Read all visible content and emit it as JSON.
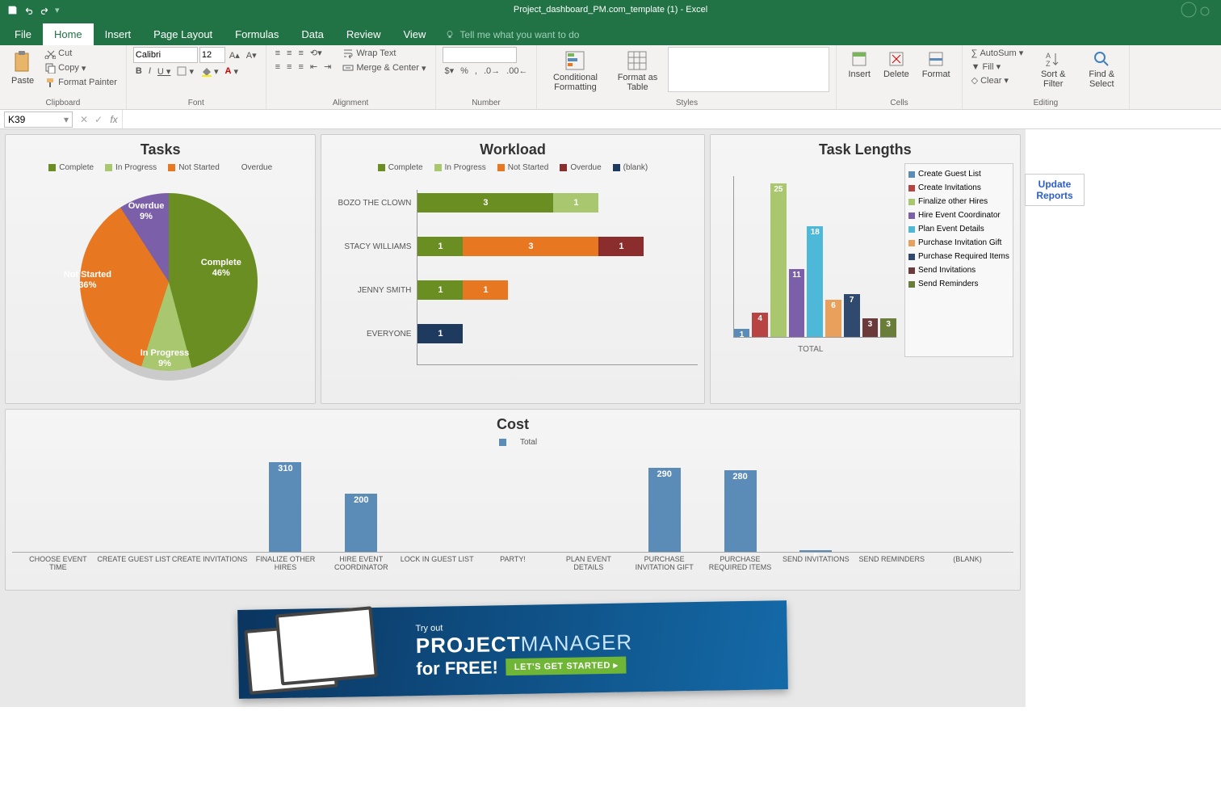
{
  "titlebar": {
    "title": "Project_dashboard_PM.com_template (1) - Excel"
  },
  "tabs": [
    "File",
    "Home",
    "Insert",
    "Page Layout",
    "Formulas",
    "Data",
    "Review",
    "View"
  ],
  "tell_me": "Tell me what you want to do",
  "ribbon": {
    "clipboard": {
      "paste": "Paste",
      "cut": "Cut",
      "copy": "Copy",
      "format_painter": "Format Painter",
      "label": "Clipboard"
    },
    "font": {
      "name": "Calibri",
      "size": "12",
      "label": "Font"
    },
    "alignment": {
      "wrap": "Wrap Text",
      "merge": "Merge & Center",
      "label": "Alignment"
    },
    "number": {
      "label": "Number"
    },
    "styles": {
      "cond": "Conditional Formatting",
      "fat": "Format as Table",
      "label": "Styles"
    },
    "cells": {
      "insert": "Insert",
      "delete": "Delete",
      "format": "Format",
      "label": "Cells"
    },
    "editing": {
      "autosum": "AutoSum",
      "fill": "Fill",
      "clear": "Clear",
      "sort": "Sort & Filter",
      "find": "Find & Select",
      "label": "Editing"
    }
  },
  "name_box": "K39",
  "update_btn": "Update Reports",
  "chart_data": {
    "tasks": {
      "type": "pie",
      "title": "Tasks",
      "legend": [
        "Complete",
        "In Progress",
        "Not Started",
        "Overdue"
      ],
      "slices": [
        {
          "label": "Complete",
          "pct": 46,
          "color": "#6b8e23"
        },
        {
          "label": "In Progress",
          "pct": 9,
          "color": "#a8c76e"
        },
        {
          "label": "Not Started",
          "pct": 36,
          "color": "#e87722"
        },
        {
          "label": "Overdue",
          "pct": 9,
          "color": "#7b5fa8"
        }
      ]
    },
    "workload": {
      "type": "bar",
      "title": "Workload",
      "legend": [
        "Complete",
        "In Progress",
        "Not Started",
        "Overdue",
        "(blank)"
      ],
      "categories": [
        "BOZO THE CLOWN",
        "STACY WILLIAMS",
        "JENNY SMITH",
        "EVERYONE"
      ],
      "series": [
        {
          "name": "Complete",
          "color": "#6b8e23",
          "values": [
            3,
            1,
            1,
            0
          ]
        },
        {
          "name": "In Progress",
          "color": "#a8c76e",
          "values": [
            1,
            0,
            0,
            0
          ]
        },
        {
          "name": "Not Started",
          "color": "#e87722",
          "values": [
            0,
            3,
            1,
            0
          ]
        },
        {
          "name": "Overdue",
          "color": "#8b2d2d",
          "values": [
            0,
            1,
            0,
            0
          ]
        },
        {
          "name": "(blank)",
          "color": "#1f3a5f",
          "values": [
            0,
            0,
            0,
            1
          ]
        }
      ]
    },
    "task_lengths": {
      "type": "bar",
      "title": "Task Lengths",
      "xlabel": "TOTAL",
      "items": [
        {
          "name": "Create Guest List",
          "value": 1,
          "color": "#5b8cb8"
        },
        {
          "name": "Create Invitations",
          "value": 4,
          "color": "#b84343"
        },
        {
          "name": "Finalize other Hires",
          "value": 25,
          "color": "#a8c76e"
        },
        {
          "name": "Hire Event Coordinator",
          "value": 11,
          "color": "#7b5fa8"
        },
        {
          "name": "Plan Event Details",
          "value": 18,
          "color": "#4db8d8"
        },
        {
          "name": "Purchase Invitation Gift",
          "value": 6,
          "color": "#e8a05c"
        },
        {
          "name": "Purchase Required Items",
          "value": 7,
          "color": "#2f4a6e"
        },
        {
          "name": "Send Invitations",
          "value": 3,
          "color": "#6b3a3a"
        },
        {
          "name": "Send Reminders",
          "value": 3,
          "color": "#6b7d3a"
        }
      ]
    },
    "cost": {
      "type": "bar",
      "title": "Cost",
      "legend": [
        "Total"
      ],
      "categories": [
        "CHOOSE EVENT TIME",
        "CREATE GUEST LIST",
        "CREATE INVITATIONS",
        "FINALIZE OTHER HIRES",
        "HIRE EVENT COORDINATOR",
        "LOCK IN GUEST LIST",
        "PARTY!",
        "PLAN EVENT DETAILS",
        "PURCHASE INVITATION GIFT",
        "PURCHASE REQUIRED ITEMS",
        "SEND INVITATIONS",
        "SEND REMINDERS",
        "(BLANK)"
      ],
      "values": [
        0,
        0,
        0,
        310,
        200,
        0,
        0,
        0,
        290,
        280,
        5,
        0,
        0
      ]
    }
  },
  "banner": {
    "line1": "Try out",
    "line2a": "PROJECT",
    "line2b": "MANAGER",
    "line3": "for FREE!",
    "cta": "LET'S GET STARTED ▸"
  }
}
